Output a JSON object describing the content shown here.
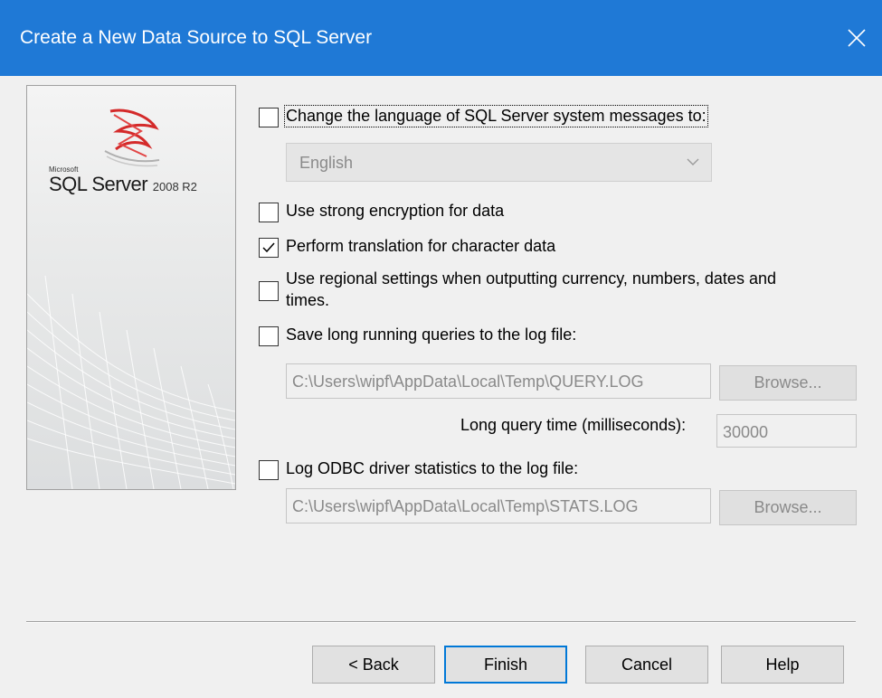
{
  "window": {
    "title": "Create a New Data Source to SQL Server",
    "close_glyph": "✕"
  },
  "brand": {
    "small": "Microsoft",
    "name": "SQL Server",
    "version": "2008 R2"
  },
  "options": {
    "change_language": {
      "label": "Change the language of SQL Server system messages to:",
      "checked": false,
      "dropdown_value": "English"
    },
    "strong_encryption": {
      "label": "Use strong encryption for data",
      "checked": false
    },
    "translation": {
      "label": "Perform translation for character data",
      "checked": true
    },
    "regional_settings": {
      "label_line1": "Use regional settings when outputting currency, numbers, dates and",
      "label_line2": "times.",
      "checked": false
    },
    "long_queries": {
      "label": "Save long running queries to the log file:",
      "checked": false,
      "path": "C:\\Users\\wipf\\AppData\\Local\\Temp\\QUERY.LOG",
      "browse": "Browse...",
      "time_label": "Long query time (milliseconds):",
      "time_value": "30000"
    },
    "odbc_stats": {
      "label": "Log ODBC driver statistics to the log file:",
      "checked": false,
      "path": "C:\\Users\\wipf\\AppData\\Local\\Temp\\STATS.LOG",
      "browse": "Browse..."
    }
  },
  "buttons": {
    "back": "< Back",
    "finish": "Finish",
    "cancel": "Cancel",
    "help": "Help"
  },
  "colors": {
    "titlebar": "#1f79d6",
    "default_button_border": "#0078d7"
  }
}
